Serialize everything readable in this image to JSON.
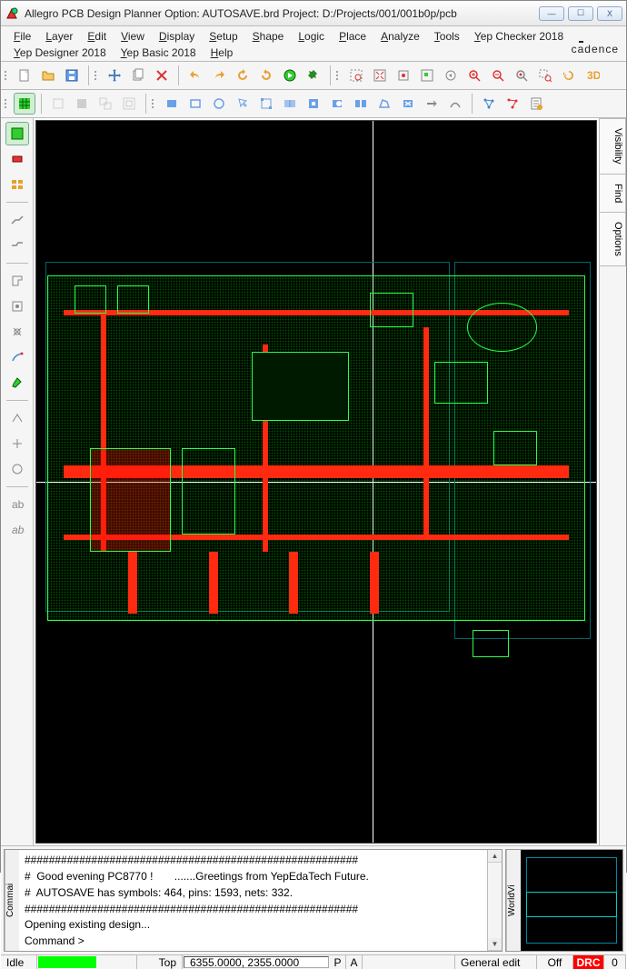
{
  "window": {
    "title": "Allegro PCB Design Planner Option: AUTOSAVE.brd   Project:  D:/Projects/001/001b0p/pcb",
    "min": "—",
    "max": "☐",
    "close": "X"
  },
  "menu": {
    "items": [
      {
        "u": "F",
        "rest": "ile"
      },
      {
        "u": "L",
        "rest": "ayer"
      },
      {
        "u": "E",
        "rest": "dit"
      },
      {
        "u": "V",
        "rest": "iew"
      },
      {
        "u": "D",
        "rest": "isplay"
      },
      {
        "u": "S",
        "rest": "etup"
      },
      {
        "u": "S",
        "rest": "hape"
      },
      {
        "u": "L",
        "rest": "ogic"
      },
      {
        "u": "P",
        "rest": "lace"
      },
      {
        "u": "A",
        "rest": "nalyze"
      },
      {
        "u": "T",
        "rest": "ools"
      },
      {
        "u": "Y",
        "rest": "ep Checker 2018"
      },
      {
        "u": "Y",
        "rest": "ep Designer 2018"
      },
      {
        "u": "Y",
        "rest": "ep Basic 2018"
      },
      {
        "u": "H",
        "rest": "elp"
      }
    ],
    "brand_pre": "c",
    "brand_a": "a",
    "brand_post": "dence"
  },
  "right_tabs": {
    "t1": "Visibility",
    "t2": "Find",
    "t3": "Options"
  },
  "console": {
    "label": "Commai",
    "line1": "#######################################################",
    "line2": "#  Good evening PC8770 !       .......Greetings from YepEdaTech Future.",
    "line3": "#  AUTOSAVE has symbols: 464, pins: 1593, nets: 332.",
    "line4": "#######################################################",
    "line5": "Opening existing design...",
    "line6": "Command >"
  },
  "worldview": {
    "label": "WorldVi"
  },
  "status": {
    "idle": "Idle",
    "layer": "Top",
    "coords": "6355.0000, 2355.0000",
    "p": "P",
    "a": "A",
    "mode": "General edit",
    "off": "Off",
    "drc": "DRC",
    "count": "0"
  }
}
